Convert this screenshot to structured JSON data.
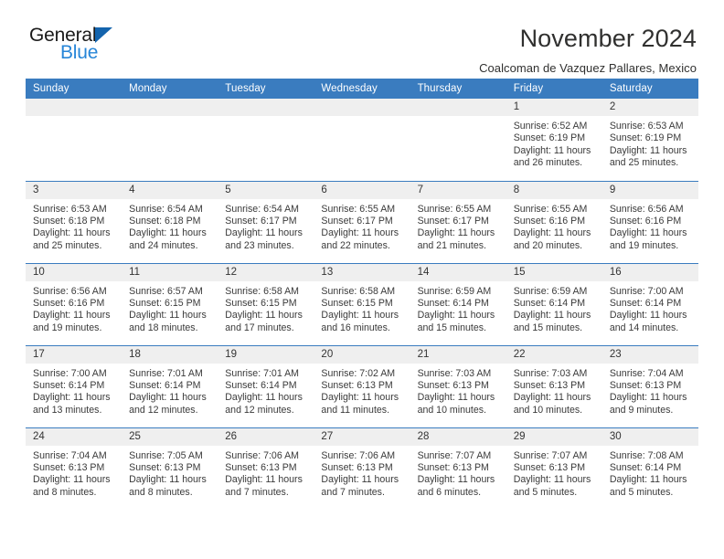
{
  "logo": {
    "word1": "General",
    "word2": "Blue",
    "triangle_color": "#1464ad",
    "blue_color": "#2786d8"
  },
  "header": {
    "title": "November 2024",
    "location": "Coalcoman de Vazquez Pallares, Mexico"
  },
  "theme": {
    "header_blue": "#3a7cbf",
    "daynum_band": "#efefef",
    "rule_blue": "#3a7cbf"
  },
  "weekday_headers": [
    "Sunday",
    "Monday",
    "Tuesday",
    "Wednesday",
    "Thursday",
    "Friday",
    "Saturday"
  ],
  "weeks": [
    [
      {
        "day": "",
        "info": ""
      },
      {
        "day": "",
        "info": ""
      },
      {
        "day": "",
        "info": ""
      },
      {
        "day": "",
        "info": ""
      },
      {
        "day": "",
        "info": ""
      },
      {
        "day": "1",
        "info": "Sunrise: 6:52 AM\nSunset: 6:19 PM\nDaylight: 11 hours and 26 minutes."
      },
      {
        "day": "2",
        "info": "Sunrise: 6:53 AM\nSunset: 6:19 PM\nDaylight: 11 hours and 25 minutes."
      }
    ],
    [
      {
        "day": "3",
        "info": "Sunrise: 6:53 AM\nSunset: 6:18 PM\nDaylight: 11 hours and 25 minutes."
      },
      {
        "day": "4",
        "info": "Sunrise: 6:54 AM\nSunset: 6:18 PM\nDaylight: 11 hours and 24 minutes."
      },
      {
        "day": "5",
        "info": "Sunrise: 6:54 AM\nSunset: 6:17 PM\nDaylight: 11 hours and 23 minutes."
      },
      {
        "day": "6",
        "info": "Sunrise: 6:55 AM\nSunset: 6:17 PM\nDaylight: 11 hours and 22 minutes."
      },
      {
        "day": "7",
        "info": "Sunrise: 6:55 AM\nSunset: 6:17 PM\nDaylight: 11 hours and 21 minutes."
      },
      {
        "day": "8",
        "info": "Sunrise: 6:55 AM\nSunset: 6:16 PM\nDaylight: 11 hours and 20 minutes."
      },
      {
        "day": "9",
        "info": "Sunrise: 6:56 AM\nSunset: 6:16 PM\nDaylight: 11 hours and 19 minutes."
      }
    ],
    [
      {
        "day": "10",
        "info": "Sunrise: 6:56 AM\nSunset: 6:16 PM\nDaylight: 11 hours and 19 minutes."
      },
      {
        "day": "11",
        "info": "Sunrise: 6:57 AM\nSunset: 6:15 PM\nDaylight: 11 hours and 18 minutes."
      },
      {
        "day": "12",
        "info": "Sunrise: 6:58 AM\nSunset: 6:15 PM\nDaylight: 11 hours and 17 minutes."
      },
      {
        "day": "13",
        "info": "Sunrise: 6:58 AM\nSunset: 6:15 PM\nDaylight: 11 hours and 16 minutes."
      },
      {
        "day": "14",
        "info": "Sunrise: 6:59 AM\nSunset: 6:14 PM\nDaylight: 11 hours and 15 minutes."
      },
      {
        "day": "15",
        "info": "Sunrise: 6:59 AM\nSunset: 6:14 PM\nDaylight: 11 hours and 15 minutes."
      },
      {
        "day": "16",
        "info": "Sunrise: 7:00 AM\nSunset: 6:14 PM\nDaylight: 11 hours and 14 minutes."
      }
    ],
    [
      {
        "day": "17",
        "info": "Sunrise: 7:00 AM\nSunset: 6:14 PM\nDaylight: 11 hours and 13 minutes."
      },
      {
        "day": "18",
        "info": "Sunrise: 7:01 AM\nSunset: 6:14 PM\nDaylight: 11 hours and 12 minutes."
      },
      {
        "day": "19",
        "info": "Sunrise: 7:01 AM\nSunset: 6:14 PM\nDaylight: 11 hours and 12 minutes."
      },
      {
        "day": "20",
        "info": "Sunrise: 7:02 AM\nSunset: 6:13 PM\nDaylight: 11 hours and 11 minutes."
      },
      {
        "day": "21",
        "info": "Sunrise: 7:03 AM\nSunset: 6:13 PM\nDaylight: 11 hours and 10 minutes."
      },
      {
        "day": "22",
        "info": "Sunrise: 7:03 AM\nSunset: 6:13 PM\nDaylight: 11 hours and 10 minutes."
      },
      {
        "day": "23",
        "info": "Sunrise: 7:04 AM\nSunset: 6:13 PM\nDaylight: 11 hours and 9 minutes."
      }
    ],
    [
      {
        "day": "24",
        "info": "Sunrise: 7:04 AM\nSunset: 6:13 PM\nDaylight: 11 hours and 8 minutes."
      },
      {
        "day": "25",
        "info": "Sunrise: 7:05 AM\nSunset: 6:13 PM\nDaylight: 11 hours and 8 minutes."
      },
      {
        "day": "26",
        "info": "Sunrise: 7:06 AM\nSunset: 6:13 PM\nDaylight: 11 hours and 7 minutes."
      },
      {
        "day": "27",
        "info": "Sunrise: 7:06 AM\nSunset: 6:13 PM\nDaylight: 11 hours and 7 minutes."
      },
      {
        "day": "28",
        "info": "Sunrise: 7:07 AM\nSunset: 6:13 PM\nDaylight: 11 hours and 6 minutes."
      },
      {
        "day": "29",
        "info": "Sunrise: 7:07 AM\nSunset: 6:13 PM\nDaylight: 11 hours and 5 minutes."
      },
      {
        "day": "30",
        "info": "Sunrise: 7:08 AM\nSunset: 6:14 PM\nDaylight: 11 hours and 5 minutes."
      }
    ]
  ]
}
